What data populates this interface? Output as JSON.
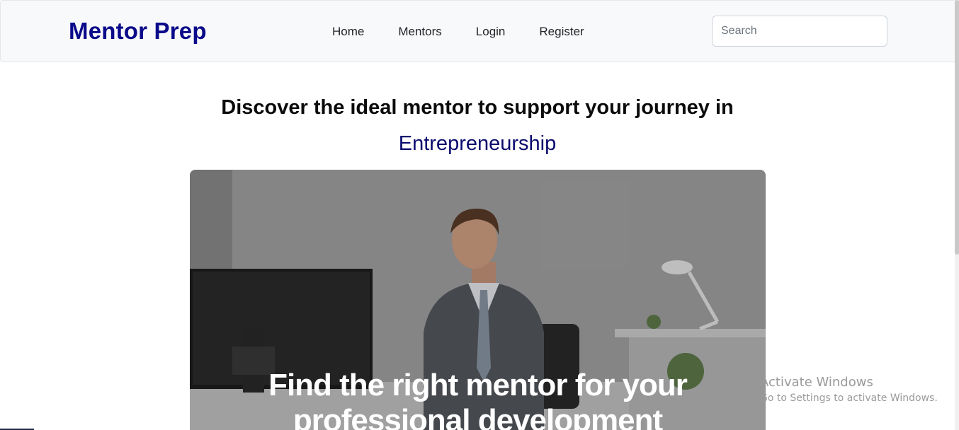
{
  "navbar": {
    "brand": "Mentor Prep",
    "links": [
      {
        "label": "Home"
      },
      {
        "label": "Mentors"
      },
      {
        "label": "Login"
      },
      {
        "label": "Register"
      }
    ],
    "search": {
      "placeholder": "Search",
      "value": ""
    }
  },
  "main": {
    "headline": "Discover the ideal mentor to support your journey in",
    "subject": "Entrepreneurship",
    "hero": {
      "line1": "Find the right mentor for your",
      "line2": "professional development"
    }
  },
  "watermark": {
    "title": "Activate Windows",
    "subtitle": "Go to Settings to activate Windows."
  },
  "colors": {
    "brand": "#0a0a8a",
    "subject": "#0a0a6e",
    "navbar_bg": "#f8f9fb"
  }
}
